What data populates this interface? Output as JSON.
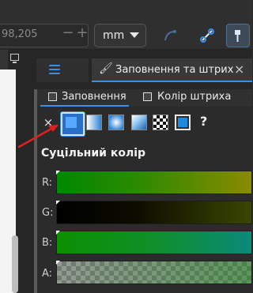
{
  "toolbar": {
    "coord_value": "98,205",
    "stepper_minus": "−",
    "stepper_plus": "+",
    "unit_value": "mm"
  },
  "dock": {
    "tab_label": "Заповнення та штрих",
    "close_glyph": "×"
  },
  "subtabs": {
    "fill_label": "Заповнення",
    "stroke_label": "Колір штриха"
  },
  "paint_types": {
    "none_glyph": "×",
    "unset_glyph": "?",
    "selected": "flat-color"
  },
  "section": {
    "title": "Суцільний колір"
  },
  "channels": {
    "r": "R:",
    "g": "G:",
    "b": "B:",
    "a": "A:"
  },
  "colors": {
    "accent": "#3a8ee6",
    "annotation_arrow": "#e02020",
    "selected_color": "#1d8ae0"
  }
}
